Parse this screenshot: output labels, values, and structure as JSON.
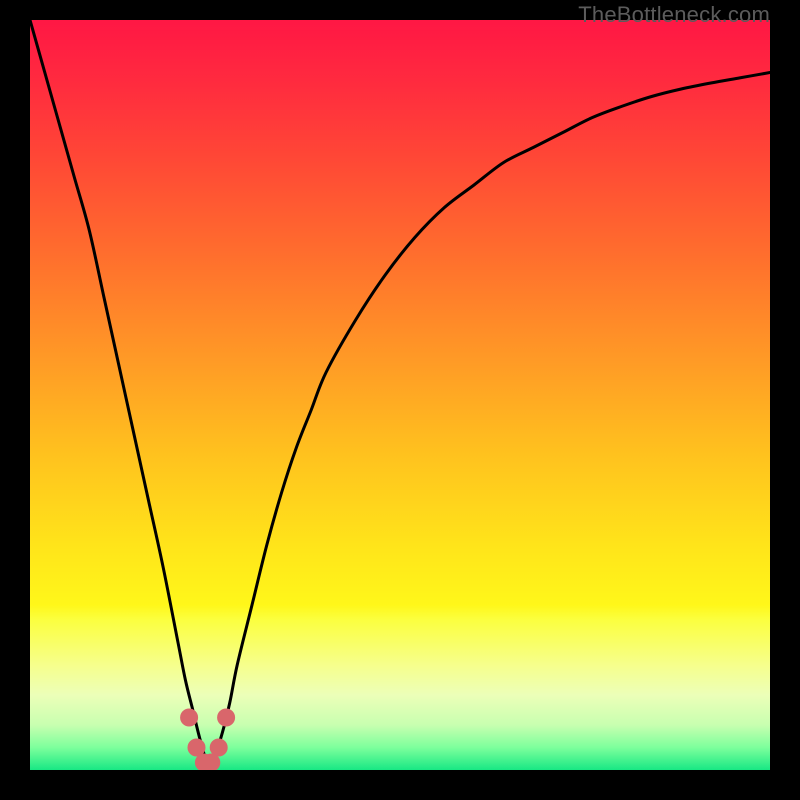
{
  "watermark": "TheBottleneck.com",
  "colors": {
    "gradient_stops": [
      {
        "offset": 0.0,
        "color": "#ff1744"
      },
      {
        "offset": 0.08,
        "color": "#ff2a3f"
      },
      {
        "offset": 0.18,
        "color": "#ff4636"
      },
      {
        "offset": 0.3,
        "color": "#ff6a2e"
      },
      {
        "offset": 0.45,
        "color": "#ff9926"
      },
      {
        "offset": 0.58,
        "color": "#ffc21e"
      },
      {
        "offset": 0.7,
        "color": "#ffe41a"
      },
      {
        "offset": 0.78,
        "color": "#fff71a"
      },
      {
        "offset": 0.8,
        "color": "#fbff40"
      },
      {
        "offset": 0.86,
        "color": "#f6ff8c"
      },
      {
        "offset": 0.9,
        "color": "#ecffb8"
      },
      {
        "offset": 0.94,
        "color": "#c8ffb0"
      },
      {
        "offset": 0.97,
        "color": "#7dff9c"
      },
      {
        "offset": 1.0,
        "color": "#18e884"
      }
    ],
    "curve_stroke": "#000000",
    "marker_fill": "#d9666b",
    "background": "#000000"
  },
  "chart_data": {
    "type": "line",
    "title": "",
    "xlabel": "",
    "ylabel": "",
    "xlim": [
      0,
      100
    ],
    "ylim": [
      0,
      100
    ],
    "x_dip": 24,
    "series": [
      {
        "name": "bottleneck-curve",
        "x": [
          0,
          2,
          4,
          6,
          8,
          10,
          12,
          14,
          16,
          18,
          20,
          21,
          22,
          23,
          24,
          25,
          26,
          27,
          28,
          30,
          32,
          34,
          36,
          38,
          40,
          44,
          48,
          52,
          56,
          60,
          64,
          68,
          72,
          76,
          80,
          84,
          88,
          92,
          96,
          100
        ],
        "y": [
          100,
          93,
          86,
          79,
          72,
          63,
          54,
          45,
          36,
          27,
          17,
          12,
          8,
          4,
          1,
          2,
          5,
          9,
          14,
          22,
          30,
          37,
          43,
          48,
          53,
          60,
          66,
          71,
          75,
          78,
          81,
          83,
          85,
          87,
          88.5,
          89.8,
          90.8,
          91.6,
          92.3,
          93
        ]
      },
      {
        "name": "dip-markers",
        "x": [
          21.5,
          22.5,
          23.5,
          24.5,
          25.5,
          26.5
        ],
        "y": [
          7,
          3,
          1,
          1,
          3,
          7
        ]
      }
    ],
    "annotations": []
  }
}
